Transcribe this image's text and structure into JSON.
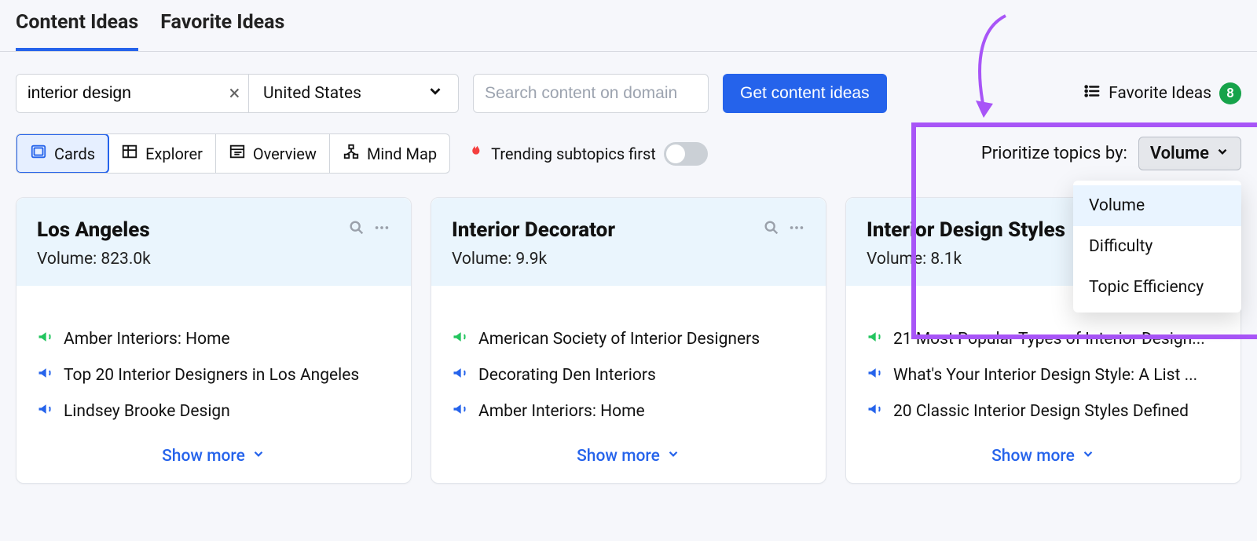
{
  "tabs": {
    "content_ideas": "Content Ideas",
    "favorite_ideas": "Favorite Ideas"
  },
  "toolbar": {
    "keyword_value": "interior design",
    "country_value": "United States",
    "domain_placeholder": "Search content on domain",
    "get_ideas_label": "Get content ideas",
    "favorite_link_label": "Favorite Ideas",
    "favorite_count": "8"
  },
  "views": {
    "cards": "Cards",
    "explorer": "Explorer",
    "overview": "Overview",
    "mindmap": "Mind Map"
  },
  "trending_label": "Trending subtopics first",
  "prioritize": {
    "label": "Prioritize topics by:",
    "selected": "Volume",
    "options": [
      "Volume",
      "Difficulty",
      "Topic Efficiency"
    ]
  },
  "cards": [
    {
      "title": "Los Angeles",
      "volume": "Volume: 823.0k",
      "items": [
        {
          "color": "green",
          "text": "Amber Interiors: Home"
        },
        {
          "color": "blue",
          "text": "Top 20 Interior Designers in Los Angeles"
        },
        {
          "color": "blue",
          "text": "Lindsey Brooke Design"
        }
      ]
    },
    {
      "title": "Interior Decorator",
      "volume": "Volume: 9.9k",
      "items": [
        {
          "color": "green",
          "text": "American Society of Interior Designers"
        },
        {
          "color": "blue",
          "text": "Decorating Den Interiors"
        },
        {
          "color": "blue",
          "text": "Amber Interiors: Home"
        }
      ]
    },
    {
      "title": "Interior Design Styles",
      "volume": "Volume: 8.1k",
      "items": [
        {
          "color": "green",
          "text": "21 Most Popular Types of Interior Design..."
        },
        {
          "color": "blue",
          "text": "What's Your Interior Design Style: A List ..."
        },
        {
          "color": "blue",
          "text": "20 Classic Interior Design Styles Defined"
        }
      ]
    }
  ],
  "show_more_label": "Show more"
}
